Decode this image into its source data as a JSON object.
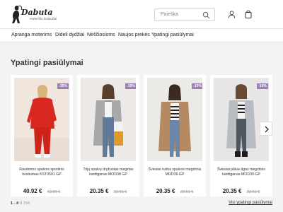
{
  "header": {
    "logo_text": "Dabuta",
    "logo_sub": "moteriški drabužiai",
    "search_placeholder": "Paieška"
  },
  "nav": {
    "items": [
      "Apranga moterims",
      "Dideli dydžiai",
      "Nėščiosioms",
      "Naujos prekės",
      "Ypatingi pasiūlymai"
    ]
  },
  "section": {
    "title": "Ypatingi pasiūlymai"
  },
  "products": [
    {
      "name": "Raudonos spalvos sportinis kostiumas KST0501 GP",
      "price": "40.92 €",
      "old_price": "62.96 €",
      "badge": "-35%"
    },
    {
      "name": "Trijų spalvų dryžuotas megztas kardiganas MOD38 GP",
      "price": "20.35 €",
      "old_price": "22.61 €",
      "badge": "-10%"
    },
    {
      "name": "Šviesiai rudos spalvos megztinis MOD39 GP",
      "price": "20.35 €",
      "old_price": "22.61 €",
      "badge": "-10%"
    },
    {
      "name": "Šviesiai pilkas ilgas megztinis kardiganas MOD39 GP",
      "price": "20.35 €",
      "old_price": "22.61 €",
      "badge": "-10%"
    }
  ],
  "pagination": {
    "range": "1 - 4",
    "total": "iš 294"
  },
  "see_all_label": "Visi ypatingi pasiūlymai",
  "colors": {
    "badge": "#9b7fb6",
    "background": "#f3f3f3"
  }
}
